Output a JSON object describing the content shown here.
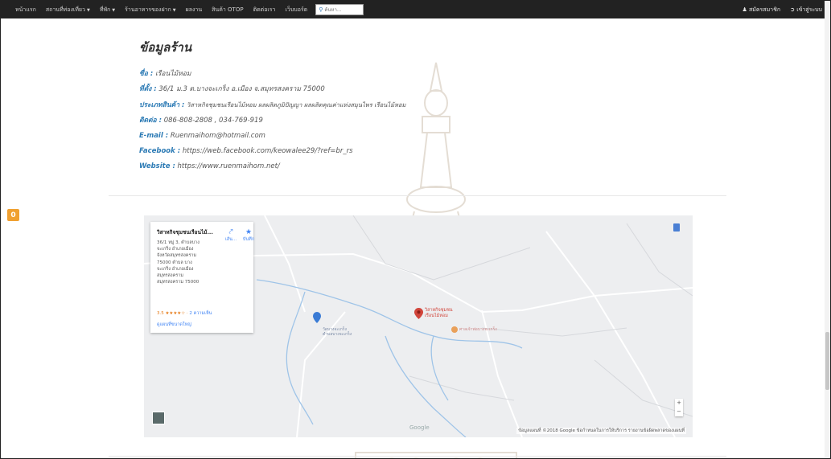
{
  "navbar": {
    "items": [
      {
        "label": "หน้าแรก",
        "dropdown": false
      },
      {
        "label": "สถานที่ท่องเที่ยว",
        "dropdown": true
      },
      {
        "label": "ที่พัก",
        "dropdown": true
      },
      {
        "label": "ร้านอาหารของฝาก",
        "dropdown": true
      },
      {
        "label": "ผลงาน",
        "dropdown": false
      },
      {
        "label": "สินค้า OTOP",
        "dropdown": false
      },
      {
        "label": "ติดต่อเรา",
        "dropdown": false
      },
      {
        "label": "เว็บบอร์ด",
        "dropdown": false
      }
    ],
    "search_placeholder": "ค้นหา...",
    "right": {
      "register": "สมัครสมาชิก",
      "login": "เข้าสู่ระบบ"
    }
  },
  "shop": {
    "heading": "ข้อมูลร้าน",
    "name_label": "ชื่อ :",
    "name": "เรือนไม้หอม",
    "address_label": "ที่ตั้ง :",
    "address": "36/1 ม.3 ต.บางจะเกร็ง อ.เมือง จ.สมุทรสงคราม 75000",
    "type_label": "ประเภทสินค้า :",
    "type": "วิสาหกิจชุมชนเรือนไม้หอม ผลผลิตภูมิปัญญา ผลผลิตคุณค่าแห่งสมุนไพร เรือนไม้หอม",
    "phone_label": "ติดต่อ :",
    "phone": "086-808-2808 , 034-769-919",
    "email_label": "E-mail :",
    "email": "Ruenmaihom@hotmail.com",
    "facebook_label": "Facebook :",
    "facebook": "https://web.facebook.com/keowalee29/?ref=br_rs",
    "website_label": "Website :",
    "website": "https://www.ruenmaihom.net/"
  },
  "side_badge": "0",
  "map": {
    "card_title": "วิสาหกิจชุมชนเรือนไม้...",
    "card_address_lines": [
      "36/1 หมู่ 3, ตำบลบาง",
      "จะเกร็ง อำเภอเมือง",
      "จังหวัดสมุทรสงคราม",
      "75000 ตำบล บาง",
      "จะเกร็ง อำเภอเมือง",
      "สมุทรสงคราม",
      "สมุทรสงคราม 75000"
    ],
    "rating": "3.5",
    "stars": "★★★★☆",
    "reviews": "2 ความเห็น",
    "directions_label": "เส้น...",
    "save_label": "บันทึก",
    "view_larger": "ดูแผนที่ขนาดใหญ่",
    "pin_label_1": "วิสาหกิจชุมชน",
    "pin_label_2": "เรือนไม้หอม",
    "poi_label": "ศาลเจ้าพ่อบางจะเกร็ง",
    "village_1": "วัดบางจะเกร็ง",
    "village_2": "ตำบลบางจะเกร็ง",
    "google": "Google",
    "attribution": "ข้อมูลแผนที่ ©2018 Google   ข้อกำหนดในการให้บริการ   รายงานข้อผิดพลาดของแผนที่",
    "zoom_in": "+",
    "zoom_out": "−"
  }
}
